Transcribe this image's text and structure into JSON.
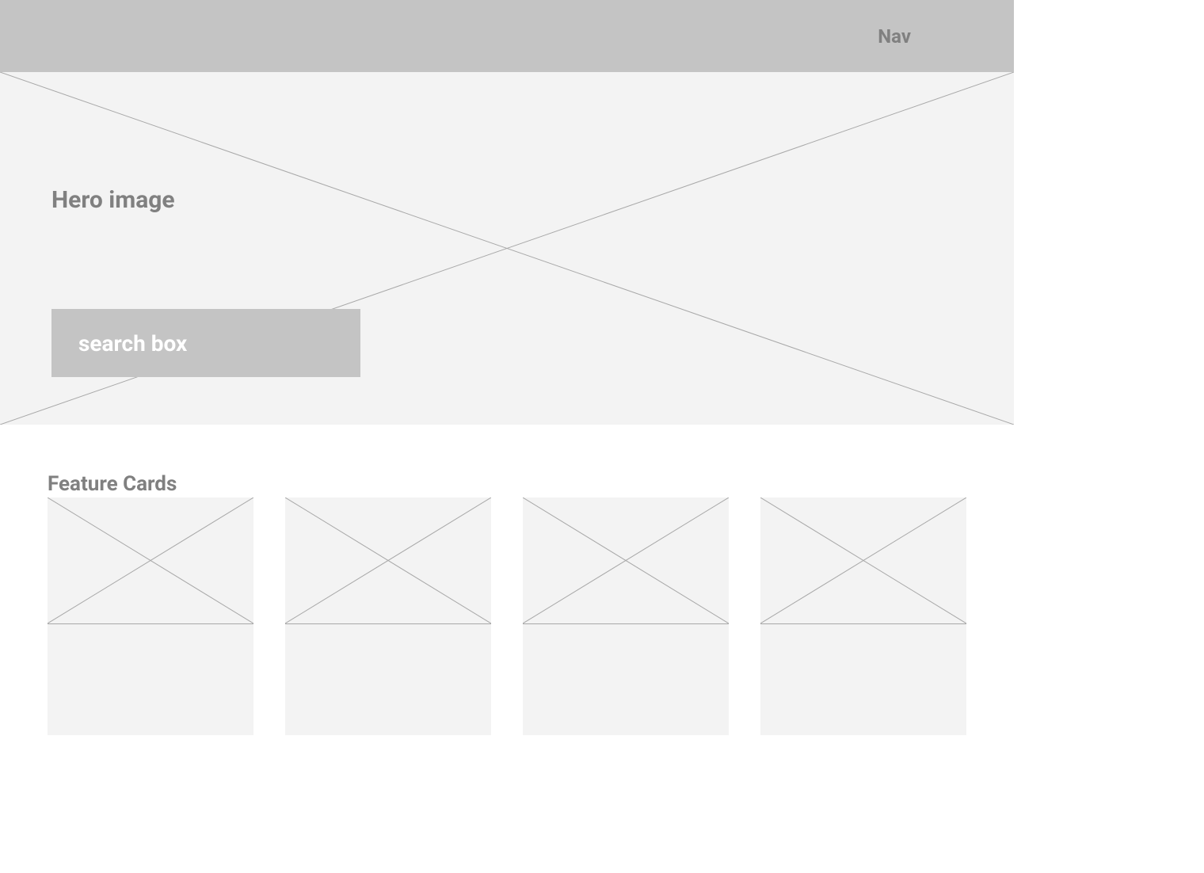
{
  "navbar": {
    "label": "Nav"
  },
  "hero": {
    "label": "Hero image",
    "search_label": "search box"
  },
  "features": {
    "title": "Feature Cards",
    "cards": [
      {
        "id": 1
      },
      {
        "id": 2
      },
      {
        "id": 3
      },
      {
        "id": 4
      }
    ]
  },
  "colors": {
    "placeholder_bg": "#f3f3f3",
    "bar_bg": "#c4c4c4",
    "label_gray": "#808080",
    "line_gray": "#a8a8a8",
    "white": "#ffffff"
  }
}
